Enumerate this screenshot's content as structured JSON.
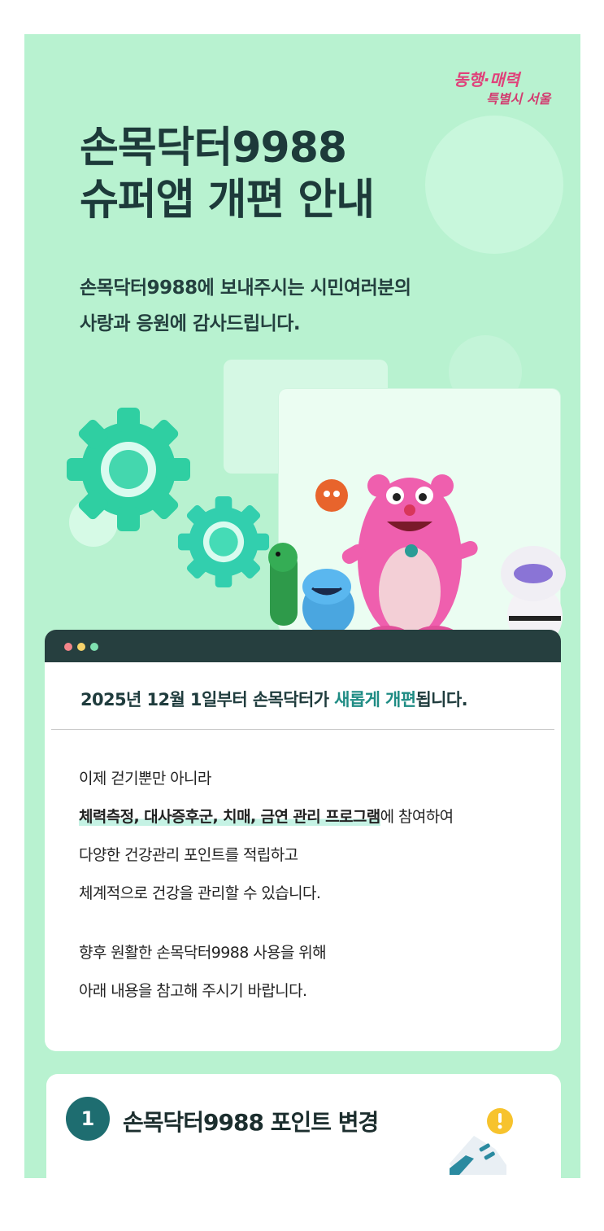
{
  "logo": {
    "line1": "동행·매력",
    "line2": "특별시 서울"
  },
  "title": {
    "line1": "손목닥터9988",
    "line2": "슈퍼앱 개편 안내"
  },
  "subtitle": {
    "line1": "손목닥터9988에 보내주시는 시민여러분의",
    "line2": "사랑과 응원에 감사드립니다."
  },
  "notice": {
    "heading_pre": "2025년 12월 1일부터 손목닥터가 ",
    "heading_accent": "새롭게 개편",
    "heading_post": "됩니다.",
    "line1": "이제 걷기뿐만 아니라",
    "line2_bold": "체력측정, 대사증후군, 치매, 금연 관리 프로그램",
    "line2_rest": "에 참여하여",
    "line3": "다양한 건강관리 포인트를 적립하고",
    "line4": "체계적으로 건강을 관리할 수 있습니다.",
    "line5": "향후 원활한 손목닥터9988 사용을 위해",
    "line6": "아래 내용을 참고해 주시기 바랍니다."
  },
  "section1": {
    "number": "1",
    "title": "손목닥터9988 포인트 변경"
  },
  "colors": {
    "background": "#b8f2d0",
    "title": "#1d3a3a",
    "accent": "#1f8c84",
    "window_bar": "#263f3f",
    "badge": "#1e6d70"
  },
  "icons": [
    "gear-icon",
    "close-dot-icon",
    "minimize-dot-icon",
    "maximize-dot-icon",
    "sneaker-icon",
    "alert-icon"
  ]
}
